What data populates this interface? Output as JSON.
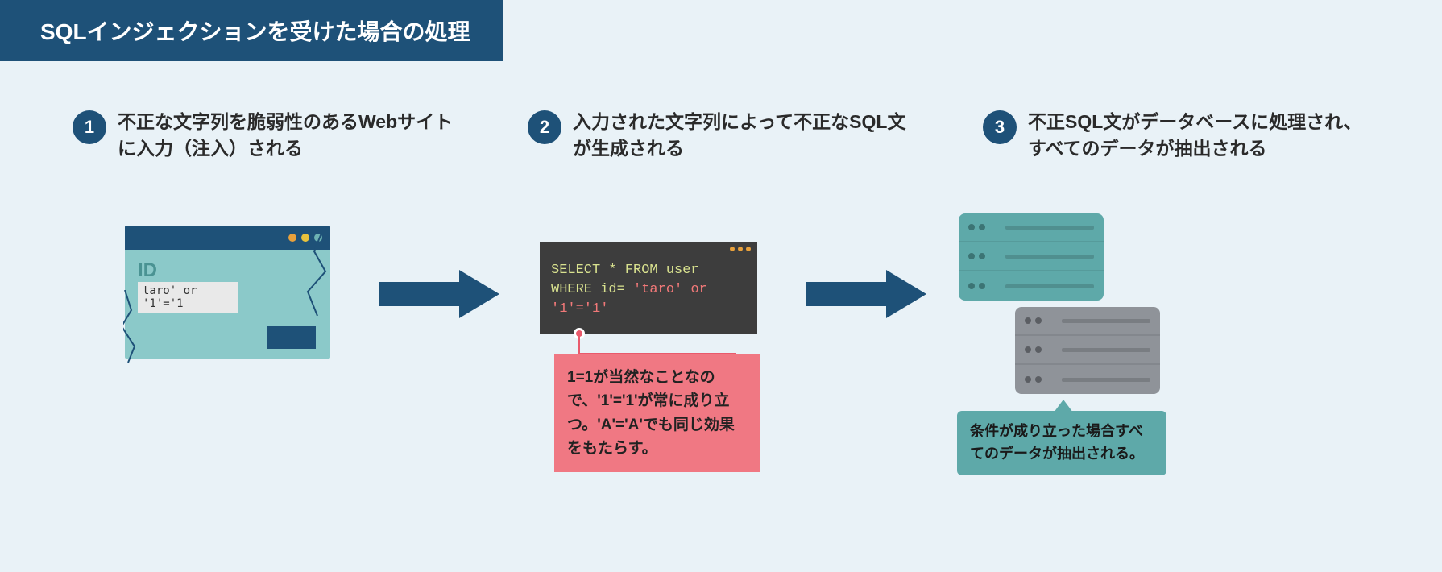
{
  "title": "SQLインジェクションを受けた場合の処理",
  "steps": [
    {
      "num": "1",
      "text": "不正な文字列を脆弱性のあるWebサイトに入力（注入）される"
    },
    {
      "num": "2",
      "text": "入力された文字列によって不正なSQL文が生成される"
    },
    {
      "num": "3",
      "text": "不正SQL文がデータベースに処理され、すべてのデータが抽出される"
    }
  ],
  "browser": {
    "id_label": "ID",
    "input_value": "taro' or '1'='1"
  },
  "terminal": {
    "line1a": "SELECT * FROM  user",
    "line2a": "WHERE id= ",
    "line2b": "'taro' or",
    "line3": "'1'='1'"
  },
  "note": "1=1が当然なことなので、'1'='1'が常に成り立つ。'A'='A'でも同じ効果をもたらす。",
  "callout": "条件が成り立った場合すべてのデータが抽出される。"
}
